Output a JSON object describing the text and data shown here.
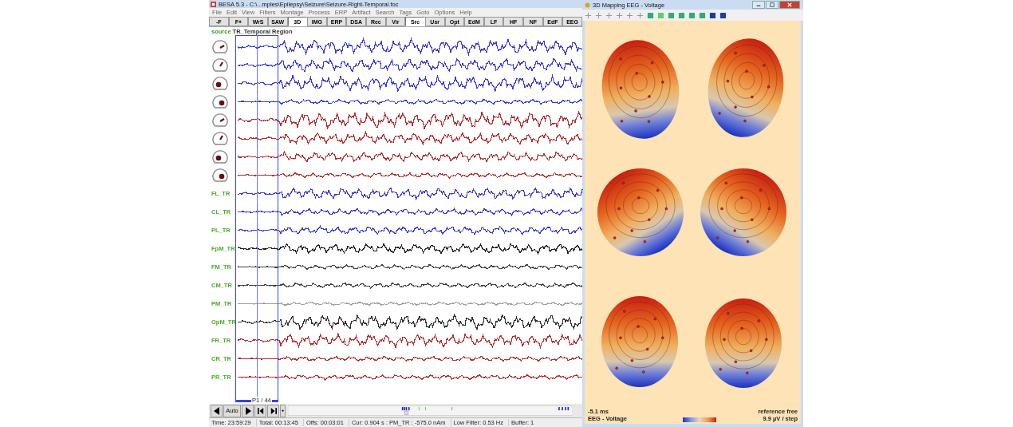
{
  "main_window": {
    "title": "BESA 5.3 - C:\\...mples\\Epilepsy\\Seizure\\Seizure-Right-Temporal.foc",
    "menu": [
      "File",
      "Edit",
      "View",
      "Filters",
      "Montage",
      "Process",
      "ERP",
      "Artifact",
      "Search",
      "Tags",
      "Goto",
      "Options",
      "Help"
    ],
    "toolbar": [
      {
        "label": "-F",
        "selected": false
      },
      {
        "label": "F+",
        "selected": false
      },
      {
        "label": "WrS",
        "selected": false
      },
      {
        "label": "SAW",
        "selected": false
      },
      {
        "label": "3D",
        "selected": true
      },
      {
        "label": "IMG",
        "selected": false
      },
      {
        "label": "ERP",
        "selected": false
      },
      {
        "label": "DSA",
        "selected": false
      },
      {
        "label": "Rec",
        "selected": false
      },
      {
        "label": "Vir",
        "selected": false
      },
      {
        "label": "Src",
        "selected": true
      },
      {
        "label": "Usr",
        "selected": false
      },
      {
        "label": "Opt",
        "selected": false
      },
      {
        "label": "EdM",
        "selected": false
      },
      {
        "label": "LF",
        "selected": false
      },
      {
        "label": "HF",
        "selected": false
      },
      {
        "label": "NF",
        "selected": false
      },
      {
        "label": "EdF",
        "selected": false
      },
      {
        "label": "EEG",
        "selected": false
      }
    ],
    "source_label": {
      "prefix": "source",
      "name": "TR_Temporal Region"
    },
    "channels": [
      {
        "kind": "source",
        "color": "#3b3bd0"
      },
      {
        "kind": "source",
        "color": "#3b3bd0"
      },
      {
        "kind": "source",
        "color": "#3b3bd0"
      },
      {
        "kind": "source",
        "color": "#3b3bd0"
      },
      {
        "kind": "source",
        "color": "#b03030"
      },
      {
        "kind": "source",
        "color": "#b03030"
      },
      {
        "kind": "source",
        "color": "#b03030"
      },
      {
        "kind": "source",
        "color": "#b03030"
      },
      {
        "kind": "label",
        "label": "FL_TR",
        "color": "#3b3bd0"
      },
      {
        "kind": "label",
        "label": "CL_TR",
        "color": "#3b3bd0"
      },
      {
        "kind": "label",
        "label": "PL_TR",
        "color": "#3b3bd0"
      },
      {
        "kind": "label",
        "label": "FpM_TR",
        "color": "#202020"
      },
      {
        "kind": "label",
        "label": "FM_TR",
        "color": "#404040"
      },
      {
        "kind": "label",
        "label": "CM_TR",
        "color": "#404040"
      },
      {
        "kind": "label",
        "label": "PM_TR",
        "color": "#a0a0a0"
      },
      {
        "kind": "label",
        "label": "OpM_TR",
        "color": "#303030"
      },
      {
        "kind": "label",
        "label": "FR_TR",
        "color": "#b03030"
      },
      {
        "kind": "label",
        "label": "CR_TR",
        "color": "#b03030"
      },
      {
        "kind": "label",
        "label": "PR_TR",
        "color": "#b03030"
      }
    ],
    "epoch_label": "P1 / 44",
    "auto_button": "Auto",
    "status_bar": [
      "Time: 23:59:29",
      "Total: 00:13:45",
      "Offs: 00:03:01",
      "Cur: 0.904 s : PM_TR : -575.0 nAm",
      "Low Filter: 0.53 Hz",
      "Buffer: 1"
    ]
  },
  "map_window": {
    "title": "3D Mapping EEG - Voltage",
    "latency": "-5.1 ms",
    "map_type": "EEG - Voltage",
    "reference": "reference free",
    "scale": "9.9 µV / step"
  }
}
